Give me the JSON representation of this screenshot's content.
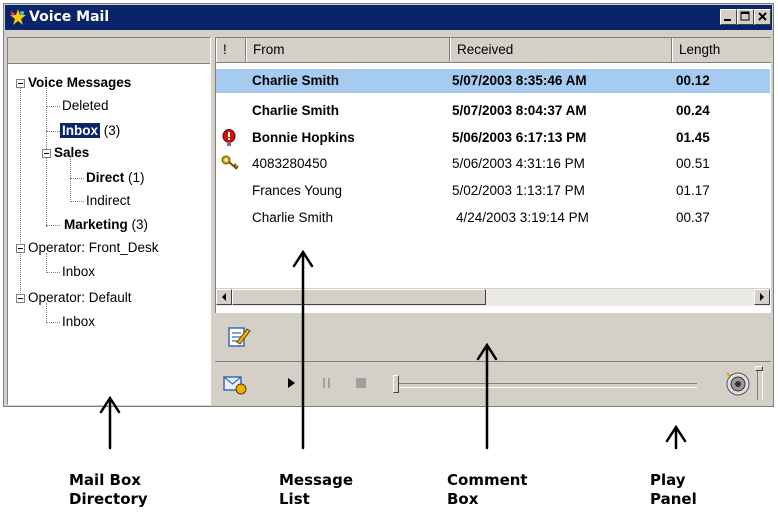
{
  "window": {
    "title": "Voice Mail"
  },
  "tree": {
    "root": "Voice Messages",
    "deleted": "Deleted",
    "inbox": "Inbox",
    "inbox_count": "(3)",
    "sales": "Sales",
    "direct": "Direct",
    "direct_count": "(1)",
    "indirect": "Indirect",
    "marketing": "Marketing",
    "marketing_count": "(3)",
    "operator_front": "Operator: Front_Desk",
    "operator_front_inbox": "Inbox",
    "operator_default": "Operator: Default",
    "operator_default_inbox": "Inbox"
  },
  "list": {
    "columns": {
      "flag": "!",
      "from": "From",
      "received": "Received",
      "length": "Length"
    },
    "rows": [
      {
        "from": "Charlie Smith",
        "received": "5/07/2003 8:35:46 AM",
        "length": "00.12",
        "unread": true,
        "selected": true,
        "icon": ""
      },
      {
        "from": "Charlie Smith",
        "received": "5/07/2003 8:04:37 AM",
        "length": "00.24",
        "unread": true,
        "selected": false,
        "icon": ""
      },
      {
        "from": "Bonnie Hopkins",
        "received": "5/06/2003 6:17:13 PM",
        "length": "01.45",
        "unread": true,
        "selected": false,
        "icon": "urgent-icon"
      },
      {
        "from": "4083280450",
        "received": "5/06/2003 4:31:16 PM",
        "length": "00.51",
        "unread": false,
        "selected": false,
        "icon": "private-key-icon"
      },
      {
        "from": "Frances Young",
        "received": "5/02/2003 1:13:17 PM",
        "length": "01.17",
        "unread": false,
        "selected": false,
        "icon": ""
      },
      {
        "from": "Charlie Smith",
        "received": "4/24/2003 3:19:14 PM",
        "length": "00.37",
        "unread": false,
        "selected": false,
        "icon": ""
      }
    ]
  },
  "callouts": {
    "mailbox": [
      "Mail Box",
      "Directory"
    ],
    "message": [
      "Message",
      "List"
    ],
    "comment": [
      "Comment",
      "Box"
    ],
    "play": [
      "Play",
      "Panel"
    ]
  },
  "colors": {
    "title_bar": "#0a246a",
    "selection": "#a6caf0",
    "tree_selection": "#0a246a",
    "chrome": "#d4d0c8"
  }
}
